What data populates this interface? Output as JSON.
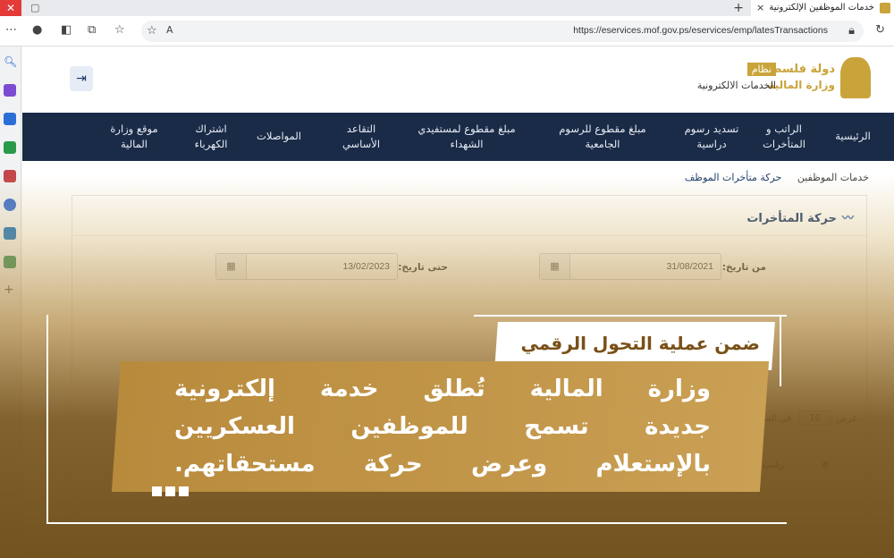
{
  "browser": {
    "tab_title": "خدمات الموظفين الإلكترونية",
    "tab_close": "×",
    "new_tab": "+",
    "url": "https://eservices.mof.gov.ps/eservices/emp/latesTransactions"
  },
  "header": {
    "logo_line1": "دولة فلسطين",
    "logo_line2": "وزارة المالية",
    "logo_badge": "نظام",
    "logo_line3": "الخدمات الالكترونية"
  },
  "nav": {
    "items": [
      "الرئيسية",
      "الراتب و المتأخرات",
      "تسديد رسوم دراسية",
      "مبلغ مقطوع للرسوم الجامعية",
      "مبلغ مقطوع لمستفيدي الشهداء",
      "التقاعد الأساسي",
      "المواصلات",
      "اشتراك الكهرباء",
      "موقع وزارة المالية"
    ]
  },
  "breadcrumb": {
    "root": "خدمات الموظفين",
    "current": "حركة متأخرات الموظف"
  },
  "card": {
    "title": "حركة المتأخرات",
    "from_label": "من تاريخ:",
    "from_value": "31/08/2021",
    "to_label": "حتى تاريخ:",
    "to_value": "13/02/2023",
    "show_label": "عرض",
    "page_size": "10",
    "per_page_label": "في الصفحة",
    "col_index": "#",
    "col_salary": "راتب شهر"
  },
  "overlay": {
    "headline": "ضمن عملية التحول الرقمي",
    "body_line1": "وزارة المالية تُطلق خدمة إلكترونية",
    "body_line2": "جديدة تسمح للموظفين العسكريين",
    "body_line3": "بالإستعلام وعرض حركة مستحقاتهم."
  }
}
